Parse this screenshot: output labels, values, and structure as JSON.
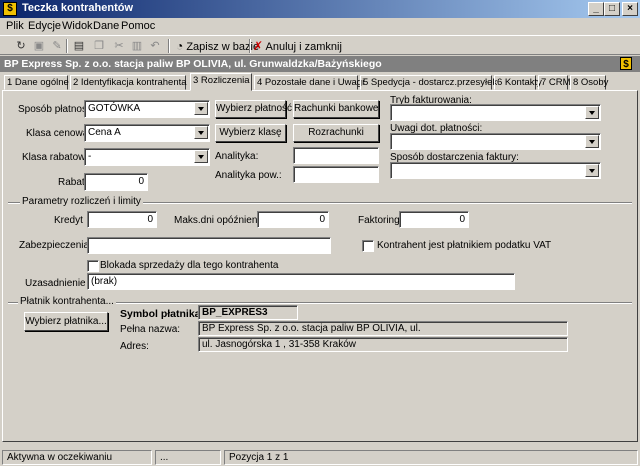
{
  "window": {
    "title": "Teczka kontrahentów",
    "icon_glyph": "$",
    "controls": [
      "_",
      "□",
      "×"
    ]
  },
  "menu": [
    "Plik",
    "Edycje",
    "Widok",
    "Dane",
    "Pomoc"
  ],
  "toolbar": {
    "icons": [
      "refresh-icon",
      "save-icon",
      "delete-icon",
      "properties-icon",
      "copy-icon",
      "cut-icon",
      "paste-icon",
      "undo-icon"
    ],
    "save_label": "Zapisz w bazie",
    "cancel_label": "Anuluj i zamknij"
  },
  "contractor": {
    "header": "BP Express Sp. z o.o.  stacja paliw BP OLIVIA, ul. Grunwaldzka/Bażyńskiego",
    "badge": "$"
  },
  "tabs": [
    "1 Dane ogólne",
    "2 Identyfikacja kontrahenta",
    "3 Rozliczenia",
    "4 Pozostałe dane i Uwagi",
    "5 Spedycja - dostarcz.przesyłek",
    "6 Kontakty",
    "7 CRM",
    "8 Osoby"
  ],
  "active_tab": "3 Rozliczenia",
  "payment": {
    "method_label": "Sposób płatności",
    "method_value": "GOTÓWKA",
    "price_class_label": "Klasa cenowa",
    "price_class_value": "Cena A",
    "discount_class_label": "Klasa rabatowa",
    "discount_class_value": "-",
    "discount_label": "Rabat",
    "discount_value": "0",
    "choose_payment_btn": "Wybierz płatność",
    "choose_class_btn": "Wybierz klasę",
    "bank_accounts_btn": "Rachunki bankowe",
    "settlements_btn": "Rozrachunki",
    "analytics_label": "Analityka:",
    "analytics_value": "",
    "analytics2_label": "Analityka pow.:",
    "analytics2_value": "",
    "billing_mode_label": "Tryb fakturowania:",
    "billing_mode_value": "",
    "payment_notes_label": "Uwagi dot. płatności:",
    "payment_notes_value": "",
    "invoice_delivery_label": "Sposób dostarczenia faktury:",
    "invoice_delivery_value": ""
  },
  "limits": {
    "group_title": "Parametry rozliczeń i limity",
    "credit_label": "Kredyt",
    "credit_value": "0",
    "max_delay_label": "Maks.dni opóźnienia:",
    "max_delay_value": "0",
    "factoring_label": "Faktoring",
    "factoring_value": "0",
    "security_label": "Zabezpieczenia",
    "security_value": "",
    "vat_payer_label": "Kontrahent jest płatnikiem podatku VAT",
    "vat_payer_checked": false,
    "sales_block_label": "Blokada sprzedaży dla tego kontrahenta",
    "sales_block_checked": false,
    "justification_label": "Uzasadnienie",
    "justification_value": "(brak)"
  },
  "payer": {
    "group_title": "Płatnik kontrahenta...",
    "choose_btn": "Wybierz płatnika...",
    "symbol_label": "Symbol płatnika:",
    "symbol_value": "BP_EXPRES3",
    "full_name_label": "Pełna nazwa:",
    "full_name_value": "BP Express Sp. z o.o.  stacja paliw BP OLIVIA, ul.",
    "address_label": "Adres:",
    "address_value": "ul. Jasnogórska 1 , 31-358 Kraków"
  },
  "status": {
    "state": "Aktywna w oczekiwaniu",
    "dots": "...",
    "position": "Pozycja 1 z 1"
  }
}
